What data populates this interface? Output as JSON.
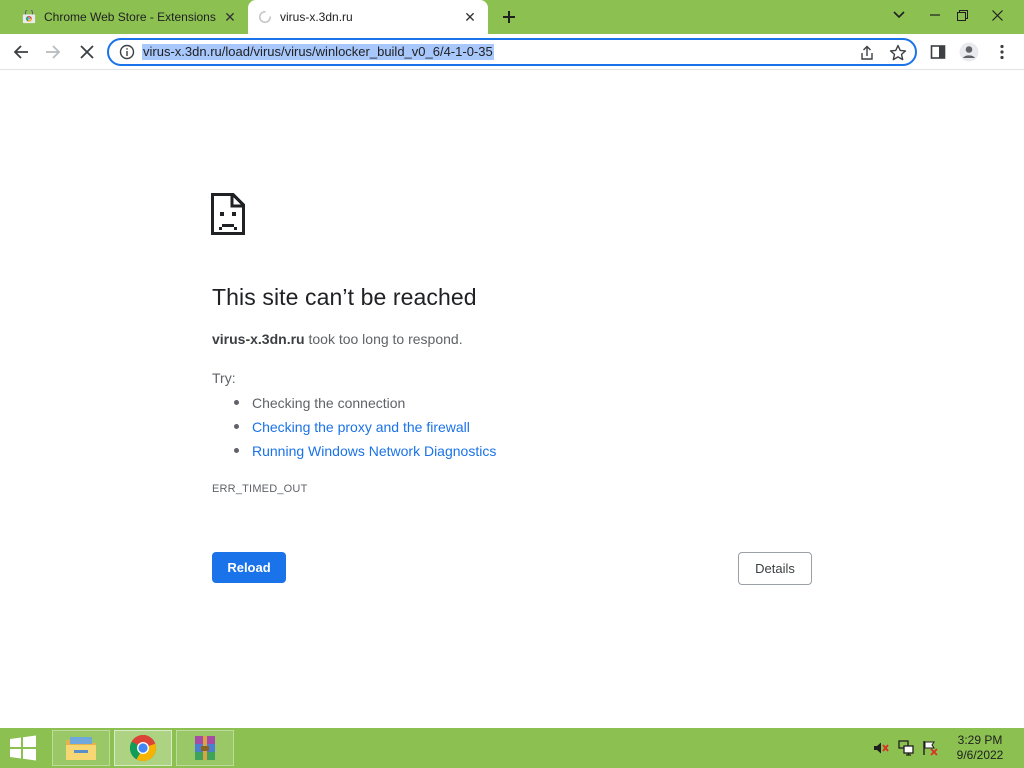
{
  "browser": {
    "tabs": [
      {
        "title": "Chrome Web Store - Extensions",
        "active": false,
        "icon": "chrome-web-store-icon"
      },
      {
        "title": "virus-x.3dn.ru",
        "active": true,
        "icon": "loading-spinner-icon"
      }
    ],
    "address": "virus-x.3dn.ru/load/virus/virus/winlocker_build_v0_6/4-1-0-35",
    "accent_color": "#1a73e8",
    "frame_color": "#8cc152"
  },
  "error_page": {
    "title": "This site can’t be reached",
    "host": "virus-x.3dn.ru",
    "desc_rest": " took too long to respond.",
    "try_label": "Try:",
    "suggestions": [
      {
        "text": "Checking the connection",
        "link": false
      },
      {
        "text": "Checking the proxy and the firewall",
        "link": true
      },
      {
        "text": "Running Windows Network Diagnostics",
        "link": true
      }
    ],
    "error_code": "ERR_TIMED_OUT",
    "reload_label": "Reload",
    "details_label": "Details"
  },
  "taskbar": {
    "apps": [
      {
        "name": "file-explorer-icon",
        "active": false
      },
      {
        "name": "chrome-icon",
        "active": true
      },
      {
        "name": "winrar-icon",
        "active": false
      }
    ],
    "clock_time": "3:29 PM",
    "clock_date": "9/6/2022"
  }
}
